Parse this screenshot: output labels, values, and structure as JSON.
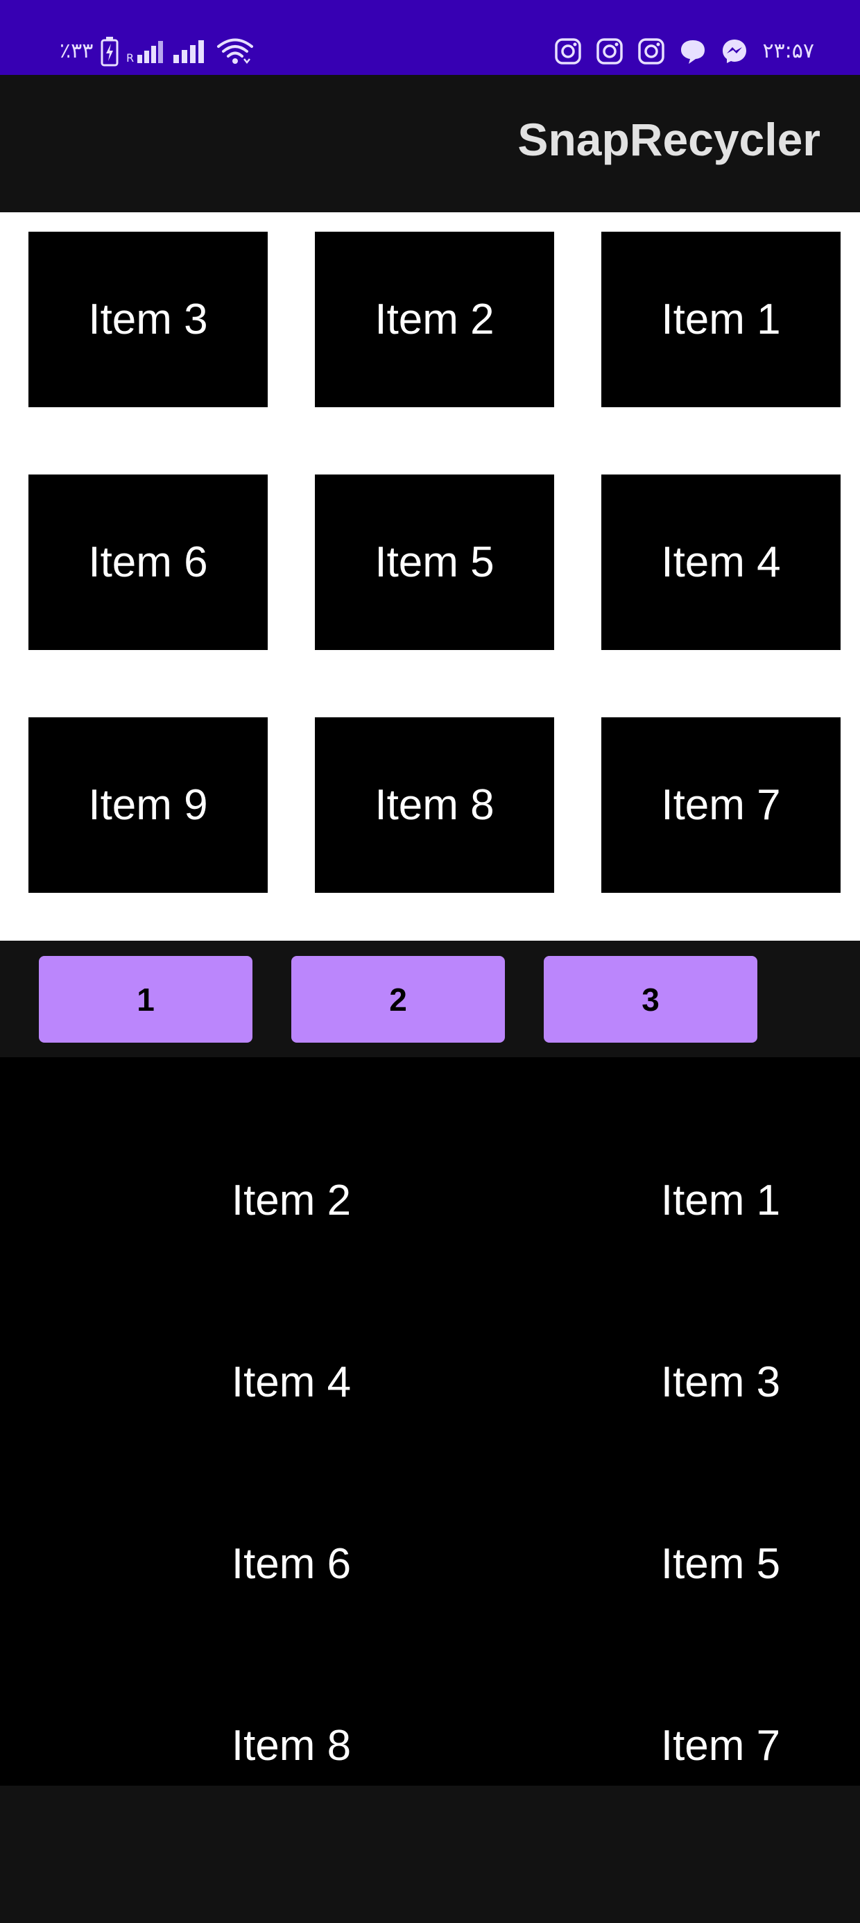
{
  "status_bar": {
    "battery_text": "٪۳۳",
    "time": "۲۳:۵۷",
    "left_icons": [
      "battery-charging-icon",
      "signal-r-icon",
      "signal-icon",
      "wifi-icon"
    ],
    "right_icons": [
      "instagram-icon",
      "instagram-icon",
      "instagram-icon",
      "chat-bubble-icon",
      "messenger-icon"
    ]
  },
  "app_bar": {
    "title": "SnapRecycler"
  },
  "grid": {
    "items": [
      "Item 3",
      "Item 2",
      "Item 1",
      "Item 6",
      "Item 5",
      "Item 4",
      "Item 9",
      "Item 8",
      "Item 7"
    ]
  },
  "page_buttons": [
    "1",
    "2",
    "3"
  ],
  "list": {
    "items": [
      "Item 2",
      "Item 1",
      "Item 4",
      "Item 3",
      "Item 6",
      "Item 5",
      "Item 8",
      "Item 7"
    ]
  },
  "colors": {
    "status_bar": "#3700b3",
    "app_bar": "#121212",
    "button": "#bb86fc",
    "grid_background": "#ffffff",
    "item_background": "#000000"
  }
}
